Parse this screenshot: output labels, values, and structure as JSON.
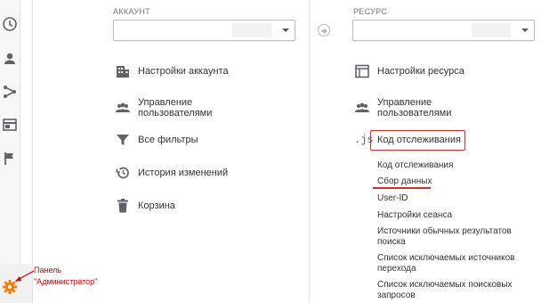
{
  "account": {
    "label": "АККАУНТ",
    "items": [
      {
        "label": "Настройки аккаунта",
        "icon": "building-icon"
      },
      {
        "label_line1": "Управление",
        "label_line2": "пользователями",
        "icon": "users-icon"
      },
      {
        "label": "Все фильтры",
        "icon": "filter-icon"
      },
      {
        "label": "История изменений",
        "icon": "history-icon"
      },
      {
        "label": "Корзина",
        "icon": "trash-icon"
      }
    ]
  },
  "property": {
    "label": "РЕСУРС",
    "items": [
      {
        "label": "Настройки ресурса",
        "icon": "window-icon"
      },
      {
        "label_line1": "Управление",
        "label_line2": "пользователями",
        "icon": "users-icon"
      },
      {
        "label": "Код отслеживания",
        "icon_text": ".js"
      }
    ],
    "subitems": [
      "Код отслеживания",
      "Сбор данных",
      "User-ID",
      "Настройки сеанса",
      "Источники обычных результатов",
      "поиска",
      "Список исключаемых источников",
      "перехода",
      "Список исключаемых поисковых",
      "запросов"
    ]
  },
  "annotation": {
    "line1": "Панель",
    "line2": "\"Администратор\""
  },
  "colors": {
    "highlight": "#d32f2f",
    "gear": "#f57c00",
    "icon": "#5f6368"
  }
}
